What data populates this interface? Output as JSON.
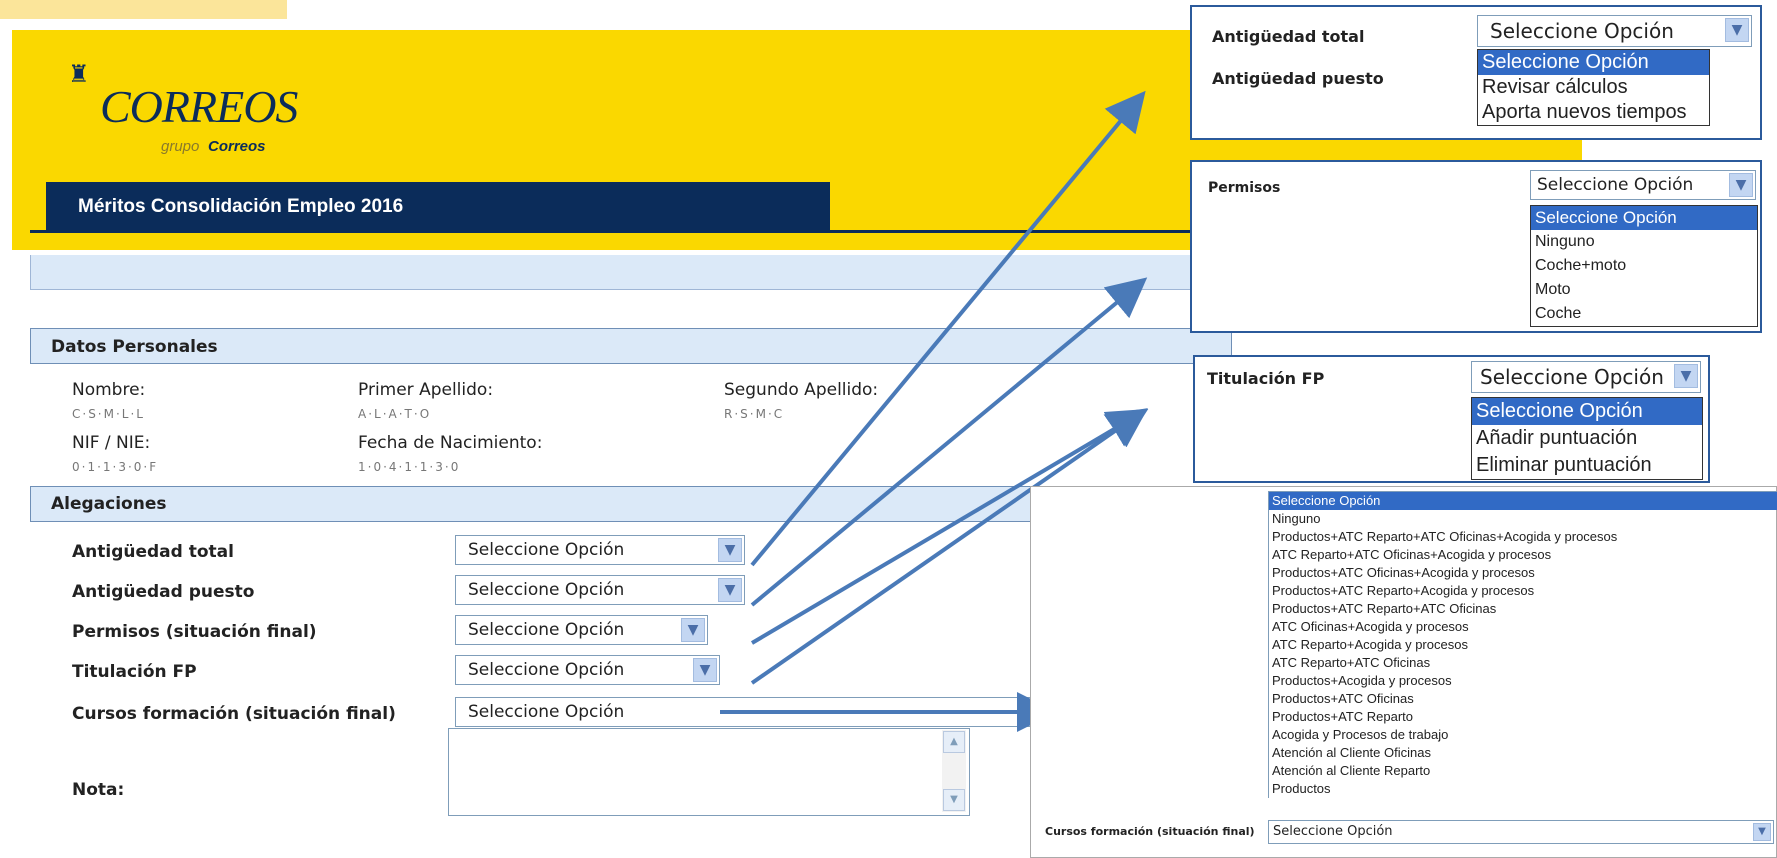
{
  "header": {
    "logo_text": "CORREOS",
    "logo_sub_a": "grupo",
    "logo_sub_b": "Correos",
    "title": "Méritos Consolidación Empleo 2016"
  },
  "datos_personales": {
    "heading": "Datos Personales",
    "nombre_label": "Nombre:",
    "nombre_value": "C·S·M·L·L",
    "primer_apellido_label": "Primer Apellido:",
    "primer_apellido_value": "A·L·A·T·O",
    "segundo_apellido_label": "Segundo Apellido:",
    "segundo_apellido_value": "R·S·M·C",
    "nif_label": "NIF / NIE:",
    "nif_value": "0·1·1·3·0·F",
    "fecha_label": "Fecha de Nacimiento:",
    "fecha_value": "1·0·4·1·1·3·0"
  },
  "alegaciones": {
    "heading": "Alegaciones",
    "rows": [
      {
        "label": "Antigüedad total",
        "value": "Seleccione Opción"
      },
      {
        "label": "Antigüedad puesto",
        "value": "Seleccione Opción"
      },
      {
        "label": "Permisos (situación final)",
        "value": "Seleccione Opción"
      },
      {
        "label": "Titulación FP",
        "value": "Seleccione Opción"
      },
      {
        "label": "Cursos formación (situación final)",
        "value": "Seleccione Opción"
      }
    ],
    "nota_label": "Nota:"
  },
  "popup_antiguedad": {
    "label1": "Antigüedad total",
    "label2": "Antigüedad puesto",
    "select_value": "Seleccione Opción",
    "options": [
      "Seleccione Opción",
      "Revisar cálculos",
      "Aporta nuevos tiempos"
    ]
  },
  "popup_permisos": {
    "label": "Permisos",
    "select_value": "Seleccione Opción",
    "options": [
      "Seleccione Opción",
      "Ninguno",
      "Coche+moto",
      "Moto",
      "Coche"
    ]
  },
  "popup_titulacion": {
    "label": "Titulación FP",
    "select_value": "Seleccione Opción",
    "options": [
      "Seleccione Opción",
      "Añadir puntuación",
      "Eliminar puntuación"
    ]
  },
  "popup_cursos": {
    "label": "Cursos formación (situación final)",
    "select_value": "Seleccione Opción",
    "options": [
      "Seleccione Opción",
      "Ninguno",
      "Productos+ATC Reparto+ATC Oficinas+Acogida y procesos",
      "ATC Reparto+ATC Oficinas+Acogida y procesos",
      "Productos+ATC Oficinas+Acogida y procesos",
      "Productos+ATC Reparto+Acogida y procesos",
      "Productos+ATC Reparto+ATC Oficinas",
      "ATC Oficinas+Acogida y procesos",
      "ATC Reparto+Acogida y procesos",
      "ATC Reparto+ATC Oficinas",
      "Productos+Acogida y procesos",
      "Productos+ATC Oficinas",
      "Productos+ATC Reparto",
      "Acogida y Procesos de trabajo",
      "Atención al Cliente Oficinas",
      "Atención al Cliente Reparto",
      "Productos"
    ]
  },
  "colors": {
    "brand_yellow": "#fad800",
    "brand_navy": "#0b2c5a",
    "section_blue": "#dbe9f8",
    "arrow_blue": "#4a7ab8",
    "highlight": "#316ac5"
  }
}
